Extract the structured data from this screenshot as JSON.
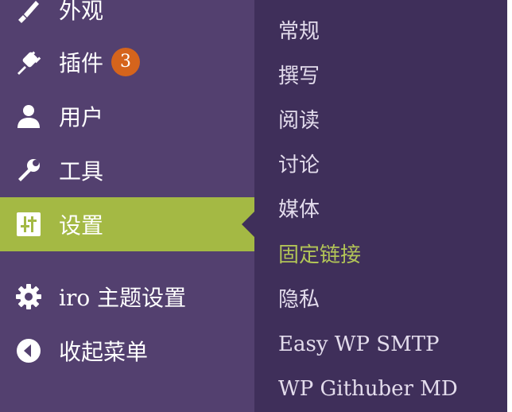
{
  "colors": {
    "sidebar_bg": "#53406f",
    "submenu_bg": "#3f2f5a",
    "active_bg": "#a4b944",
    "current_sub_text": "#b2c457",
    "badge_bg": "#d5641c"
  },
  "sidebar": {
    "items": [
      {
        "label": "外观",
        "icon": "paintbrush-icon"
      },
      {
        "label": "插件",
        "icon": "plugin-icon",
        "badge": "3"
      },
      {
        "label": "用户",
        "icon": "user-icon"
      },
      {
        "label": "工具",
        "icon": "wrench-icon"
      },
      {
        "label": "设置",
        "icon": "settings-sliders-icon",
        "active": true
      },
      {
        "label": "iro 主题设置",
        "icon": "gear-icon"
      },
      {
        "label": "收起菜单",
        "icon": "collapse-arrow-icon"
      }
    ]
  },
  "submenu": {
    "items": [
      {
        "label": "常规"
      },
      {
        "label": "撰写"
      },
      {
        "label": "阅读"
      },
      {
        "label": "讨论"
      },
      {
        "label": "媒体"
      },
      {
        "label": "固定链接",
        "current": true
      },
      {
        "label": "隐私"
      },
      {
        "label": "Easy WP SMTP"
      },
      {
        "label": "WP Githuber MD"
      }
    ]
  }
}
